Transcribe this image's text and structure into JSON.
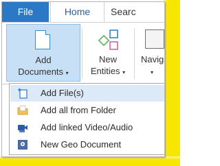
{
  "tabs": {
    "file": "File",
    "home": "Home",
    "search": "Searc"
  },
  "ribbon": {
    "add_line1": "Add",
    "add_line2": "Documents",
    "new_line1": "New",
    "new_line2": "Entities",
    "nav_line1": "Naviga",
    "dropdown_caret": "▾"
  },
  "menu": {
    "items": [
      {
        "label": "Add File(s)",
        "icon": "add-file-icon"
      },
      {
        "label": "Add all from Folder",
        "icon": "folder-icon"
      },
      {
        "label": "Add linked Video/Audio",
        "icon": "video-audio-icon"
      },
      {
        "label": "New Geo Document",
        "icon": "geo-document-icon"
      }
    ]
  },
  "colors": {
    "file_tab": "#2b78c6",
    "highlight": "#c8e0f5",
    "menu_hover": "#dce9f7",
    "annotation_frame": "#f7e600"
  }
}
